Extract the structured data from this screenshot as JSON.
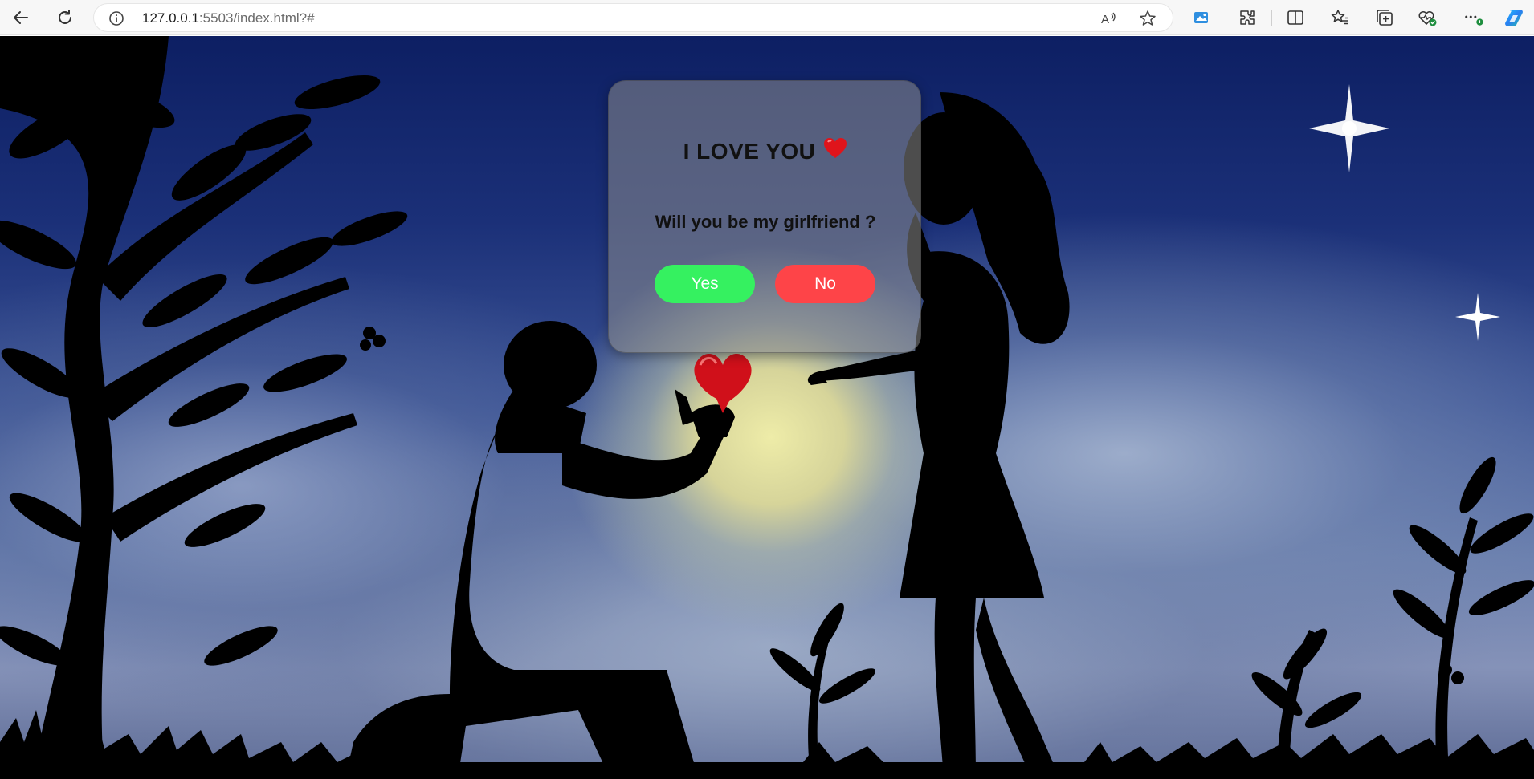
{
  "browser": {
    "url_host": "127.0.0.1",
    "url_rest": ":5503/index.html?#",
    "icons": [
      "back-icon",
      "refresh-icon",
      "info-icon",
      "read-aloud-icon",
      "favorite-star-icon",
      "image-tool-icon",
      "extensions-icon",
      "split-screen-icon",
      "favorites-icon",
      "collections-icon",
      "browser-essentials-icon",
      "more-icon",
      "copilot-icon"
    ]
  },
  "card": {
    "title": "I LOVE YOU",
    "question": "Will you be my girlfriend ?",
    "yes_label": "Yes",
    "no_label": "No"
  },
  "colors": {
    "yes_button": "#35f160",
    "no_button": "#fe4448",
    "heart": "#e0141b",
    "sky_top": "#0d1f63",
    "moon_glow": "#eeeca8"
  }
}
